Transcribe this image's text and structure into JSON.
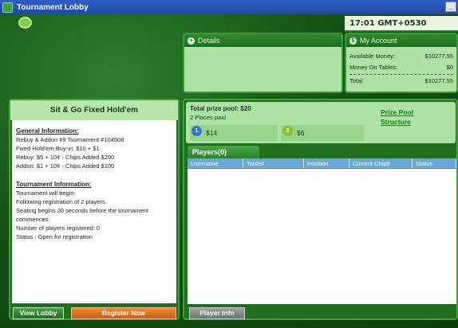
{
  "window": {
    "title": "Tournament Lobby"
  },
  "clock": "17:01 GMT+0530",
  "details": {
    "title": "Details"
  },
  "account": {
    "title": "My Account",
    "rows": [
      {
        "label": "Available Money:",
        "value": "$10277.55"
      },
      {
        "label": "Money On Tables:",
        "value": "$0"
      },
      {
        "label": "Total:",
        "value": "$10277.55"
      }
    ]
  },
  "tournament": {
    "title": "Sit & Go Fixed  Hold'em",
    "general_header": "General Information:",
    "general_lines": [
      "Rebuy & Addon #9 Tournament #104508",
      "Fixed Hold'em Buy-in: $10 + $1",
      "Rebuy: $5 + 10¢ -  Chips Added $200",
      "Addon: $1 + 10¢ -  Chips Added $100"
    ],
    "info_header": "Tournament Information:",
    "info_lines": [
      "Tournament will begin:",
      "Following registration of 2 players.",
      "Seating begins 20 seconds before the tournament",
      "commences.",
      "Number of players registered: 0",
      "Status : Open for registration"
    ],
    "view_lobby": "View Lobby",
    "register": "Register Now"
  },
  "prize": {
    "total": "Total prize pool: $20",
    "places": "2 Places paid",
    "link": "Prize Pool Structure",
    "places_list": [
      {
        "rank": "1",
        "amount": "$14",
        "color": "#3b78c9"
      },
      {
        "rank": "2",
        "amount": "$6",
        "color": "#8bbf3a"
      }
    ]
  },
  "players": {
    "tab": "Players(0)",
    "columns": [
      "Username",
      "Table#",
      "Position",
      "Current Chip#",
      "Status"
    ],
    "player_info": "Player Info"
  }
}
